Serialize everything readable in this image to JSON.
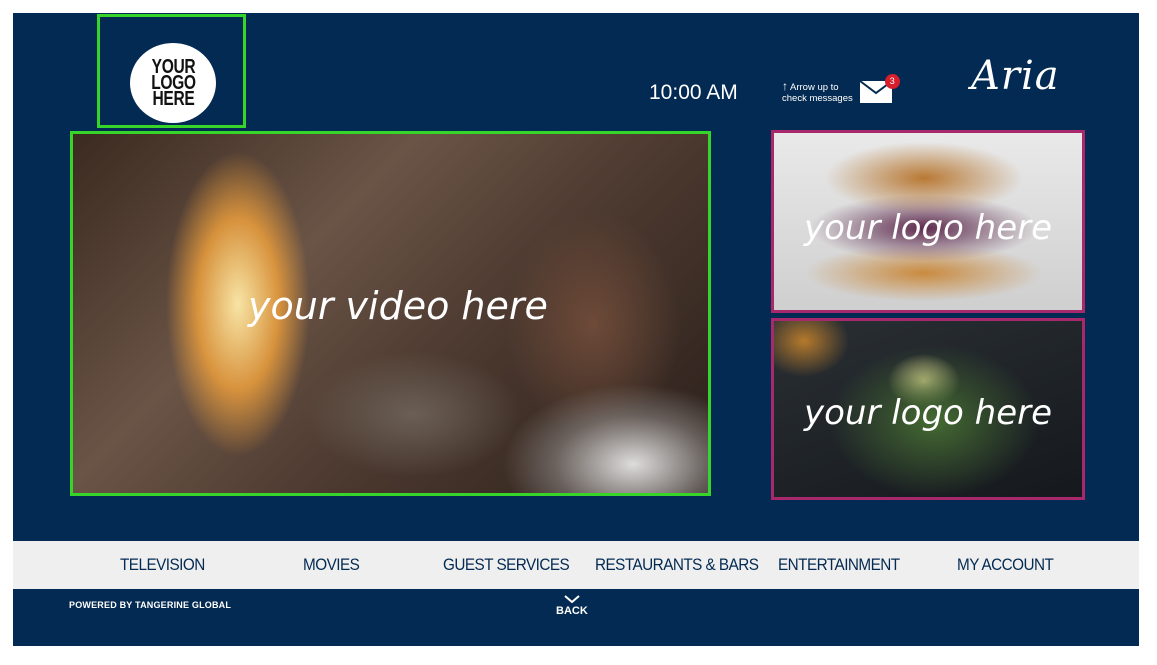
{
  "header": {
    "logo_text": "YOUR\nLOGO\nHERE",
    "clock": "10:00 AM",
    "message_hint_line1": "Arrow up to",
    "message_hint_line2": "check messages",
    "message_count": "3",
    "brand": "Aria"
  },
  "main": {
    "video_label": "your video here",
    "promos": [
      {
        "label": "your logo here"
      },
      {
        "label": "your logo here"
      }
    ]
  },
  "nav": {
    "items": [
      "TELEVISION",
      "MOVIES",
      "GUEST SERVICES",
      "RESTAURANTS & BARS",
      "ENTERTAINMENT",
      "MY ACCOUNT"
    ]
  },
  "footer": {
    "powered_by": "POWERED BY TANGERINE GLOBAL",
    "back_label": "BACK"
  },
  "colors": {
    "background": "#032a52",
    "nav_bar": "#efefef",
    "highlight_green": "#37d52a",
    "highlight_magenta": "#a8286c",
    "badge_red": "#d81e2a"
  },
  "icons": [
    "arrow-up-icon",
    "envelope-icon",
    "back-chevron-icon"
  ]
}
